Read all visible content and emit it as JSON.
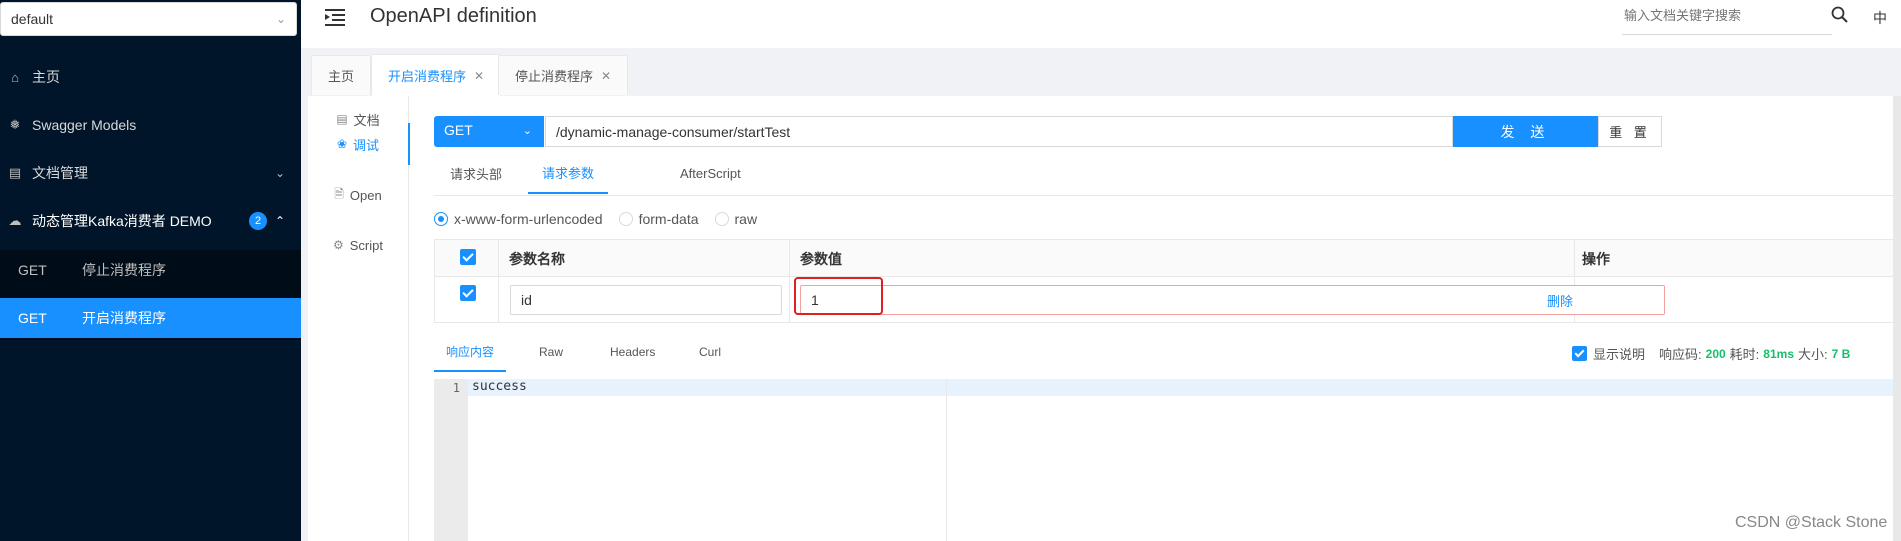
{
  "sidebar": {
    "group_select": "default",
    "menu": [
      {
        "icon": "home-icon",
        "label": "主页"
      },
      {
        "icon": "swagger-models-icon",
        "label": "Swagger Models"
      },
      {
        "icon": "document-manage-icon",
        "label": "文档管理"
      },
      {
        "icon": "cloud-icon",
        "label": "动态管理Kafka消费者 DEMO",
        "badge": "2"
      }
    ],
    "apis": [
      {
        "method": "GET",
        "label": "停止消费程序",
        "active": false
      },
      {
        "method": "GET",
        "label": "开启消费程序",
        "active": true
      }
    ]
  },
  "header": {
    "title": "OpenAPI definition",
    "search_placeholder": "输入文档关键字搜索",
    "lang": "中"
  },
  "tabs": [
    {
      "label": "主页",
      "closable": false,
      "active": false
    },
    {
      "label": "开启消费程序",
      "closable": true,
      "active": true
    },
    {
      "label": "停止消费程序",
      "closable": true,
      "active": false
    }
  ],
  "left_nav": [
    {
      "icon": "document-icon",
      "label": "文档",
      "active": false
    },
    {
      "icon": "bug-icon",
      "label": "调试",
      "active": true
    },
    {
      "icon": "file-icon",
      "label": "Open",
      "active": false
    },
    {
      "icon": "gear-icon",
      "label": "Script",
      "active": false
    }
  ],
  "request": {
    "method": "GET",
    "url": "/dynamic-manage-consumer/startTest",
    "send_label": "发 送",
    "reset_label": "重 置",
    "tabs": [
      "请求头部",
      "请求参数",
      "AfterScript"
    ],
    "active_tab": "请求参数",
    "content_types": [
      "x-www-form-urlencoded",
      "form-data",
      "raw"
    ],
    "selected_content_type": "x-www-form-urlencoded",
    "param_headers": {
      "name": "参数名称",
      "value": "参数值",
      "action": "操作"
    },
    "params": [
      {
        "checked": true,
        "name": "id",
        "value": "1",
        "action": "删除"
      }
    ]
  },
  "response": {
    "tabs": [
      "响应内容",
      "Raw",
      "Headers",
      "Curl"
    ],
    "active_tab": "响应内容",
    "show_desc_label": "显示说明",
    "status_label": "响应码:",
    "status_code": "200",
    "time_label": "耗时:",
    "time_value": "81ms",
    "size_label": "大小:",
    "size_value": "7 B",
    "line_number": "1",
    "body": "success"
  },
  "watermark": "CSDN @Stack Stone",
  "colors": {
    "primary": "#1890ff",
    "sidebar_bg": "#001529",
    "success": "#19be6b",
    "highlight": "#e02020"
  }
}
